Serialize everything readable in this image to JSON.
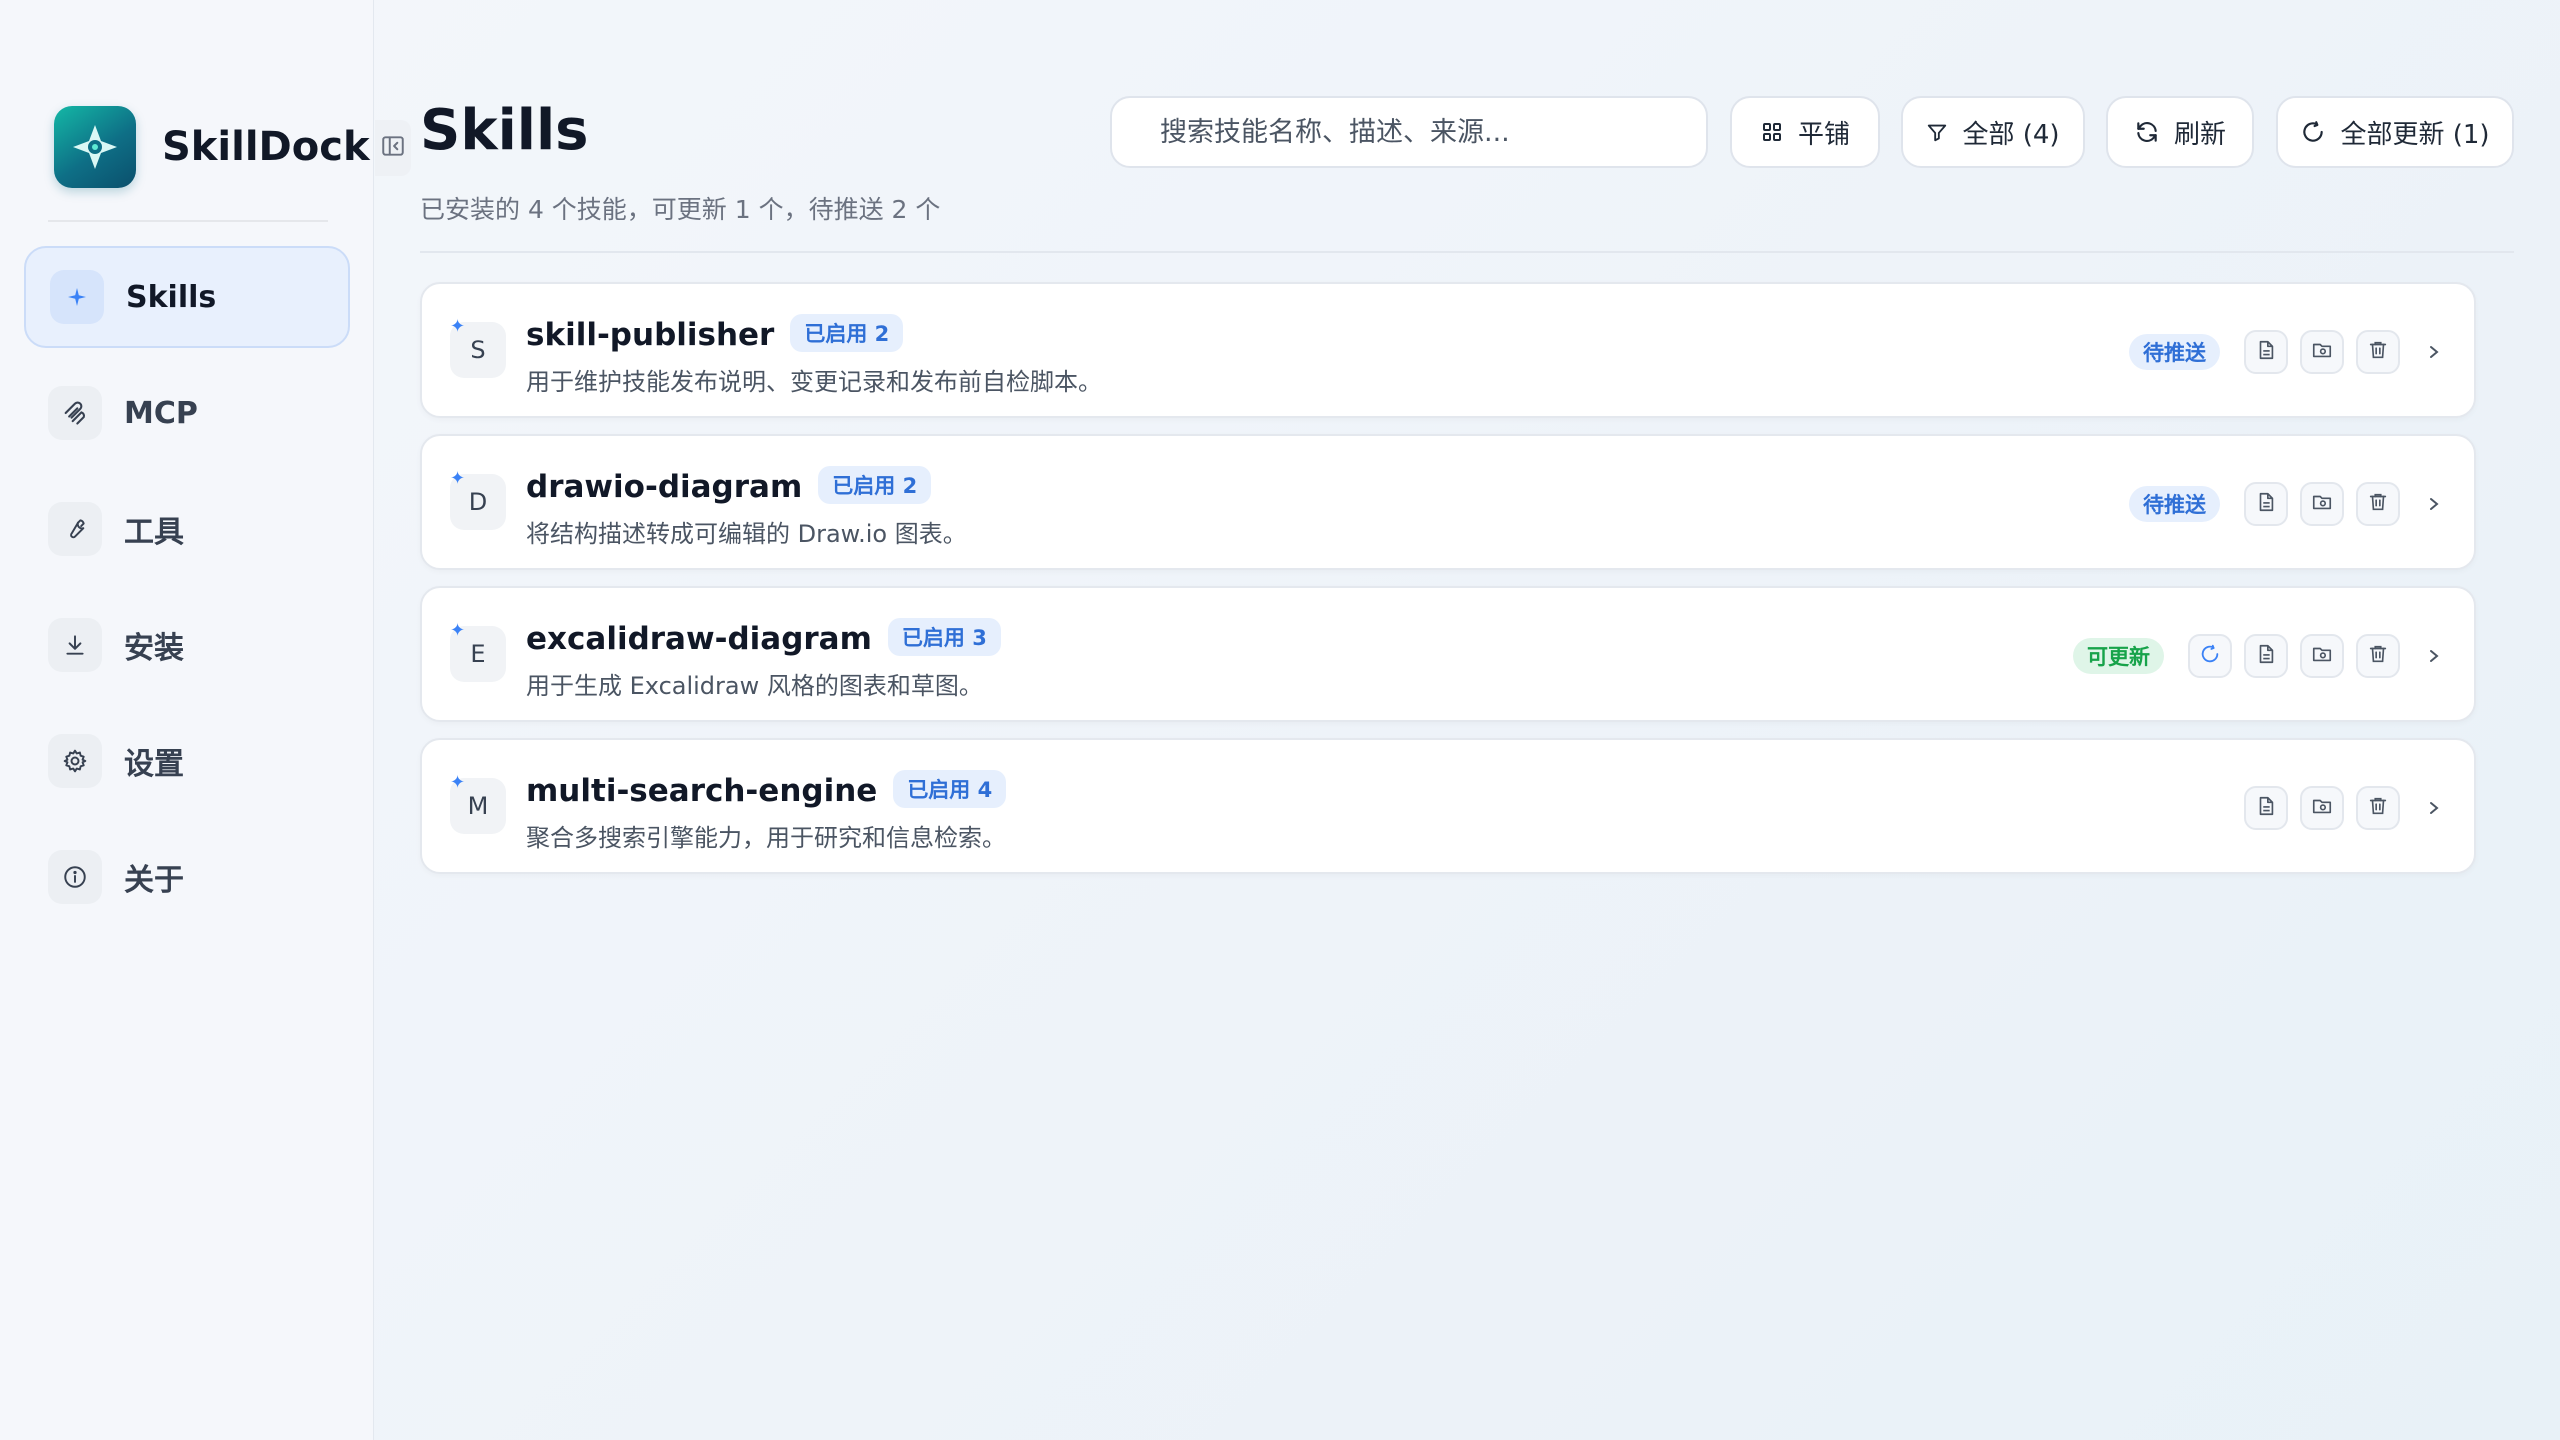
{
  "app": {
    "name": "SkillDock"
  },
  "sidebar": {
    "items": [
      {
        "label": "Skills",
        "icon": "sparkle-icon",
        "active": true
      },
      {
        "label": "MCP",
        "icon": "mcp-icon"
      },
      {
        "label": "工具",
        "icon": "wrench-icon"
      },
      {
        "label": "安装",
        "icon": "download-icon"
      },
      {
        "label": "设置",
        "icon": "gear-icon"
      },
      {
        "label": "关于",
        "icon": "info-icon"
      }
    ]
  },
  "header": {
    "title": "Skills",
    "subtitle": "已安装的 4 个技能，可更新 1 个，待推送 2 个"
  },
  "search": {
    "placeholder": "搜索技能名称、描述、来源..."
  },
  "toolbar": {
    "view_label": "平铺",
    "filter_label": "全部 (4)",
    "refresh_label": "刷新",
    "update_all_label": "全部更新 (1)"
  },
  "skills": [
    {
      "initial": "S",
      "name": "skill-publisher",
      "badge": "已启用 2",
      "description": "用于维护技能发布说明、变更记录和发布前自检脚本。",
      "status": "待推送"
    },
    {
      "initial": "D",
      "name": "drawio-diagram",
      "badge": "已启用 2",
      "description": "将结构描述转成可编辑的 Draw.io 图表。",
      "status": "待推送"
    },
    {
      "initial": "E",
      "name": "excalidraw-diagram",
      "badge": "已启用 3",
      "description": "用于生成 Excalidraw 风格的图表和草图。",
      "status": "可更新"
    },
    {
      "initial": "M",
      "name": "multi-search-engine",
      "badge": "已启用 4",
      "description": "聚合多搜索引擎能力，用于研究和信息检索。",
      "status": ""
    }
  ],
  "colors": {
    "accent": "#3b82f6",
    "badge_bg": "#e6effd",
    "update_green": "#17a34a",
    "logo_teal": "#14b8a6"
  }
}
